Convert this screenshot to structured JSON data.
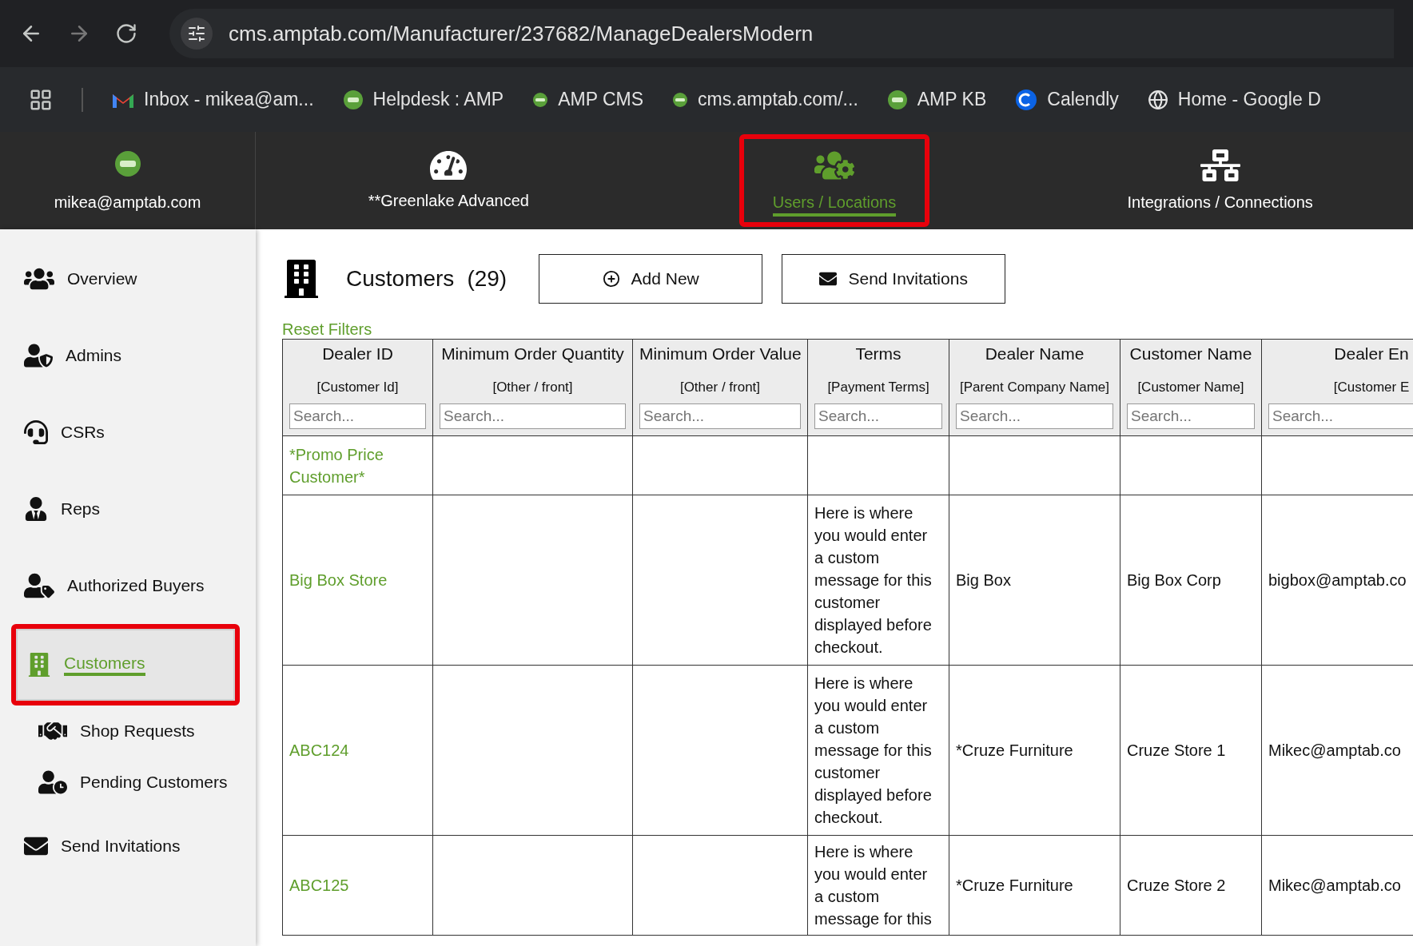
{
  "browser": {
    "url": "cms.amptab.com/Manufacturer/237682/ManageDealersModern",
    "bookmarks": [
      {
        "label": "Inbox - mikea@am...",
        "kind": "gmail"
      },
      {
        "label": "Helpdesk : AMP",
        "kind": "amp"
      },
      {
        "label": "AMP CMS",
        "kind": "amp-small"
      },
      {
        "label": "cms.amptab.com/...",
        "kind": "amp-small"
      },
      {
        "label": "AMP KB",
        "kind": "amp"
      },
      {
        "label": "Calendly",
        "kind": "calendly"
      },
      {
        "label": "Home - Google D",
        "kind": "globe"
      }
    ]
  },
  "top_nav": {
    "account": {
      "label": "mikea@amptab.com"
    },
    "items": [
      {
        "label": "**Greenlake Advanced",
        "kind": "dashboard",
        "selected": false
      },
      {
        "label": "Users / Locations",
        "kind": "users",
        "selected": true
      },
      {
        "label": "Integrations / Connections",
        "kind": "network",
        "selected": false
      }
    ]
  },
  "sidebar": {
    "items": [
      {
        "label": "Overview",
        "kind": "users",
        "selected": false
      },
      {
        "label": "Admins",
        "kind": "admin",
        "selected": false
      },
      {
        "label": "CSRs",
        "kind": "headset",
        "selected": false
      },
      {
        "label": "Reps",
        "kind": "rep",
        "selected": false
      },
      {
        "label": "Authorized Buyers",
        "kind": "buyer",
        "selected": false
      },
      {
        "label": "Customers",
        "kind": "building",
        "selected": true,
        "children": [
          {
            "label": "Shop Requests",
            "kind": "handshake",
            "selected": false
          },
          {
            "label": "Pending Customers",
            "kind": "pending",
            "selected": false
          }
        ]
      },
      {
        "label": "Send Invitations",
        "kind": "envelope",
        "selected": false
      }
    ]
  },
  "page": {
    "title": "Customers",
    "count": "(29)",
    "buttons": [
      {
        "label": "Add New",
        "kind": "add"
      },
      {
        "label": "Send Invitations",
        "kind": "envelope"
      }
    ],
    "reset_filters": "Reset Filters"
  },
  "table": {
    "columns": [
      {
        "title": "Dealer ID",
        "subtitle": "[Customer Id]",
        "placeholder": "Search..."
      },
      {
        "title": "Minimum Order Quantity",
        "subtitle": "[Other / front]",
        "placeholder": "Search..."
      },
      {
        "title": "Minimum Order Value",
        "subtitle": "[Other / front]",
        "placeholder": "Search..."
      },
      {
        "title": "Terms",
        "subtitle": "[Payment Terms]",
        "placeholder": "Search..."
      },
      {
        "title": "Dealer Name",
        "subtitle": "[Parent Company Name]",
        "placeholder": "Search..."
      },
      {
        "title": "Customer Name",
        "subtitle": "[Customer Name]",
        "placeholder": "Search..."
      },
      {
        "title": "Dealer En",
        "subtitle": "[Customer E",
        "placeholder": "Search..."
      }
    ],
    "rows": [
      {
        "cells": [
          {
            "text": "*Promo Price Customer*"
          },
          {},
          {},
          {},
          {},
          {},
          {}
        ]
      },
      {
        "cells": [
          {
            "text": "Big Box Store"
          },
          {},
          {},
          {
            "text": "Here is where you would enter a custom message for this customer displayed before checkout."
          },
          {
            "text": "Big Box"
          },
          {
            "text": "Big Box Corp"
          },
          {
            "text": "bigbox@amptab.co"
          }
        ]
      },
      {
        "cells": [
          {
            "text": "ABC124"
          },
          {},
          {},
          {
            "text": "Here is where you would enter a custom message for this customer displayed before checkout."
          },
          {
            "text": "*Cruze Furniture"
          },
          {
            "text": "Cruze Store 1"
          },
          {
            "text": "Mikec@amptab.co"
          }
        ]
      },
      {
        "cells": [
          {
            "text": "ABC125"
          },
          {},
          {},
          {
            "text": "Here is where you would enter a custom message for this"
          },
          {
            "text": "*Cruze Furniture"
          },
          {
            "text": "Cruze Store 2"
          },
          {
            "text": "Mikec@amptab.co"
          }
        ]
      }
    ]
  }
}
